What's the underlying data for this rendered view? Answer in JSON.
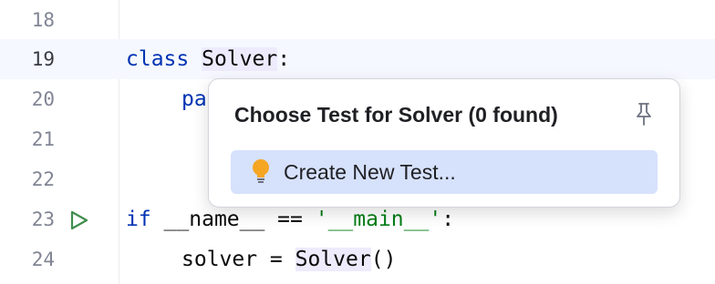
{
  "editor": {
    "lines": [
      {
        "number": "18"
      },
      {
        "number": "19"
      },
      {
        "number": "20"
      },
      {
        "number": "21"
      },
      {
        "number": "22"
      },
      {
        "number": "23"
      },
      {
        "number": "24"
      }
    ],
    "code": {
      "line19_keyword": "class",
      "line19_space": " ",
      "line19_name": "Solver",
      "line19_colon": ":",
      "line20_partial": "pa",
      "line23_keyword": "if",
      "line23_mid": " __name__ == ",
      "line23_string": "'__main__'",
      "line23_colon": ":",
      "line24_prefix": "solver = ",
      "line24_name": "Solver",
      "line24_suffix": "()"
    }
  },
  "popup": {
    "title": "Choose Test for Solver (0 found)",
    "item_label": "Create New Test..."
  },
  "icons": {
    "run": "run-gutter-icon",
    "pin": "pin-icon",
    "bulb": "lightbulb-icon"
  },
  "colors": {
    "keyword": "#0033b3",
    "string": "#067d17",
    "run_icon": "#3f8e4d",
    "bulb": "#f5a623",
    "selection": "#d6e1fc"
  }
}
